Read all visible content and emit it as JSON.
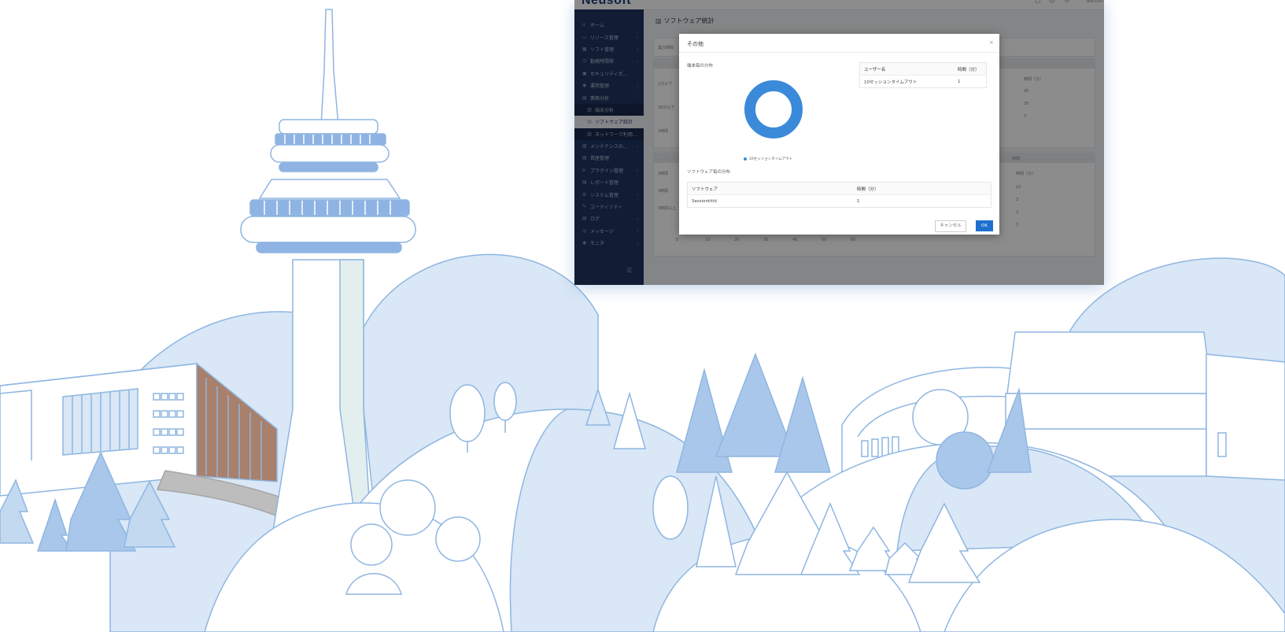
{
  "colors": {
    "line": "#8fb6e1",
    "fill_light": "#d9e7f6",
    "fill_mid": "#c3d9f0",
    "fill_dark": "#a9c7ea",
    "tower_band": "#8fb3e3",
    "brown": "#a9806b",
    "road": "#bdbdbd",
    "sidebar": "#1f3461",
    "ok": "#1e6fcf",
    "donut": "#3b8ad9"
  },
  "app": {
    "logo": "Neusoft",
    "toolbar_icons": [
      "bell-icon",
      "help-icon",
      "refresh-icon"
    ],
    "toolbar_glyphs": [
      "◻",
      "◎",
      "↻"
    ],
    "user_label": "admin"
  },
  "sidebar": {
    "items": [
      {
        "icon": "home-icon",
        "glyph": "⌂",
        "label": "ホーム",
        "caret": ""
      },
      {
        "icon": "resource-icon",
        "glyph": "▭",
        "label": "リソース管理",
        "caret": "⌄"
      },
      {
        "icon": "software-icon",
        "glyph": "▦",
        "label": "ソフト管理",
        "caret": "⌄"
      },
      {
        "icon": "clock-icon",
        "glyph": "◷",
        "label": "勤務時間帯",
        "caret": "⌄"
      },
      {
        "icon": "security-icon",
        "glyph": "▣",
        "label": "セキュリティポ...",
        "caret": ""
      },
      {
        "icon": "operation-icon",
        "glyph": "◉",
        "label": "運用管理",
        "caret": "⌄"
      },
      {
        "icon": "stats-icon",
        "glyph": "▤",
        "label": "業務分析",
        "caret": "⌃"
      },
      {
        "icon": "chart-icon",
        "glyph": "▥",
        "label": "端末分析",
        "caret": "",
        "sub": true
      },
      {
        "icon": "chart-icon",
        "glyph": "▥",
        "label": "ソフトウェア統計",
        "caret": "",
        "sub": true,
        "active": true
      },
      {
        "icon": "network-icon",
        "glyph": "▥",
        "label": "ネットワーク利用...",
        "caret": "",
        "sub": true
      },
      {
        "icon": "maintenance-icon",
        "glyph": "▧",
        "label": "メンテナンスの...",
        "caret": "⌄"
      },
      {
        "icon": "asset-icon",
        "glyph": "▤",
        "label": "資産管理",
        "caret": ""
      },
      {
        "icon": "plugin-icon",
        "glyph": "⊳",
        "label": "プラグイン管理",
        "caret": "⌄"
      },
      {
        "icon": "report-icon",
        "glyph": "▤",
        "label": "レポート管理",
        "caret": ""
      },
      {
        "icon": "system-icon",
        "glyph": "⚙",
        "label": "システム管理",
        "caret": "⌄"
      },
      {
        "icon": "utility-icon",
        "glyph": "✎",
        "label": "ユーティリティ",
        "caret": ""
      },
      {
        "icon": "log-icon",
        "glyph": "▤",
        "label": "ログ",
        "caret": "⌄"
      },
      {
        "icon": "message-icon",
        "glyph": "◎",
        "label": "メッセージ",
        "caret": "⌄"
      },
      {
        "icon": "monitor-icon",
        "glyph": "◉",
        "label": "モニタ",
        "caret": "⌄"
      }
    ],
    "collapse_glyph": "☰"
  },
  "main": {
    "title": "ソフトウェア統計",
    "filter_label": "集計期間",
    "bg_col_header": "時間（分）",
    "bg_values": [
      "30",
      "30",
      "3"
    ],
    "bg_section2": "時間",
    "bg_col_header2": "時間（分）",
    "bg_values2": [
      "10",
      "3",
      "3",
      "3"
    ],
    "bg_axis": [
      "0",
      "10",
      "20",
      "30",
      "40",
      "50",
      "60"
    ],
    "bg_row_labels": [
      "1分以下",
      "30分以下",
      "1時間",
      "2時間",
      "3時間",
      "5時間以上"
    ]
  },
  "modal": {
    "title": "その他",
    "close": "×",
    "terminal_section": "端末毎の分布",
    "user_table": {
      "headers": [
        "ユーザー名",
        "時間（分）"
      ],
      "rows": [
        [
          "10セッションタイムアウト",
          "1"
        ]
      ]
    },
    "legend": "10セッションタイムアウト",
    "software_section": "ソフトウェア毎の分布",
    "software_table": {
      "headers": [
        "ソフトウェア",
        "時間（分）"
      ],
      "rows": [
        [
          "Sessiontitld",
          "1"
        ]
      ]
    },
    "cancel": "キャンセル",
    "ok": "OK"
  }
}
